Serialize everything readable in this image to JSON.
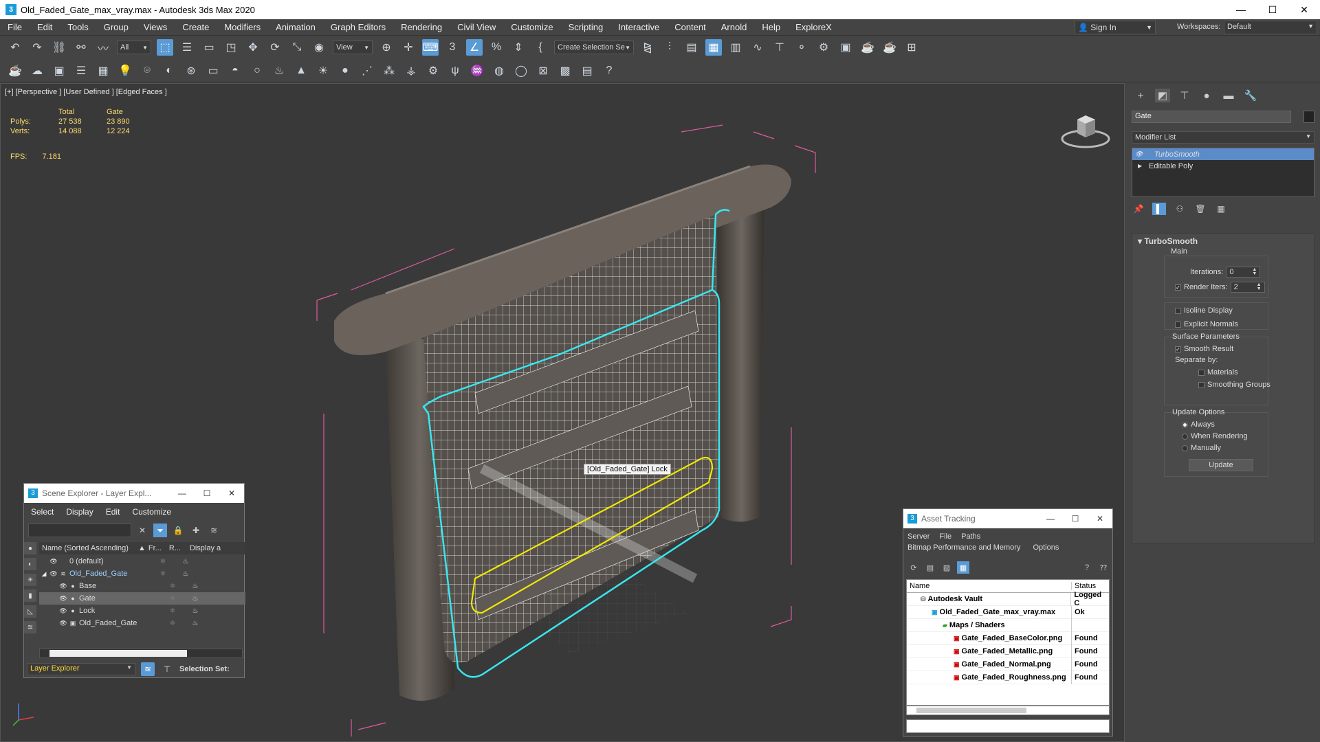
{
  "window": {
    "title": "Old_Faded_Gate_max_vray.max - Autodesk 3ds Max 2020",
    "app_icon": "3"
  },
  "menu": [
    "File",
    "Edit",
    "Tools",
    "Group",
    "Views",
    "Create",
    "Modifiers",
    "Animation",
    "Graph Editors",
    "Rendering",
    "Civil View",
    "Customize",
    "Scripting",
    "Interactive",
    "Content",
    "Arnold",
    "Help",
    "ExploreX"
  ],
  "account": {
    "sign_in": "Sign In",
    "workspaces_label": "Workspaces:",
    "workspace": "Default"
  },
  "toolbar": {
    "filter": "All",
    "view": "View",
    "selection_set": "Create Selection Se"
  },
  "viewport": {
    "label": "[+] [Perspective ] [User Defined ] [Edged Faces ]",
    "stats": {
      "col_total": "Total",
      "col_gate": "Gate",
      "polys_label": "Polys:",
      "polys_total": "27 538",
      "polys_gate": "23 890",
      "verts_label": "Verts:",
      "verts_total": "14 088",
      "verts_gate": "12 224",
      "fps_label": "FPS:",
      "fps_value": "7.181"
    },
    "tooltip": "[Old_Faded_Gate] Lock",
    "colors": {
      "selection": "#39e6ef",
      "highlight": "#f0e800",
      "bbox": "#e05aa0"
    }
  },
  "command_panel": {
    "object_name": "Gate",
    "modifier_list": "Modifier List",
    "stack": [
      {
        "label": "TurboSmooth",
        "selected": true
      },
      {
        "label": "Editable Poly",
        "selected": false
      }
    ],
    "rollout_title": "TurboSmooth",
    "main_label": "Main",
    "iterations_label": "Iterations:",
    "iterations_value": "0",
    "render_iters_label": "Render Iters:",
    "render_iters_value": "2",
    "isoline": "Isoline Display",
    "explicit_normals": "Explicit Normals",
    "surface_params": "Surface Parameters",
    "smooth_result": "Smooth Result",
    "separate_by": "Separate by:",
    "materials": "Materials",
    "smoothing_groups": "Smoothing Groups",
    "update_options": "Update Options",
    "always": "Always",
    "when_rendering": "When Rendering",
    "manually": "Manually",
    "update_button": "Update"
  },
  "scene_explorer": {
    "title": "Scene Explorer - Layer Expl...",
    "menu": [
      "Select",
      "Display",
      "Edit",
      "Customize"
    ],
    "columns": {
      "name": "Name (Sorted Ascending)",
      "sort": "▲",
      "frozen": "Fr...",
      "render": "R...",
      "display": "Display a"
    },
    "rows": [
      {
        "name": "0 (default)",
        "indent": 1,
        "selected": false
      },
      {
        "name": "Old_Faded_Gate",
        "indent": 0,
        "selected": false
      },
      {
        "name": "Base",
        "indent": 2,
        "selected": false
      },
      {
        "name": "Gate",
        "indent": 2,
        "selected": true
      },
      {
        "name": "Lock",
        "indent": 2,
        "selected": false
      },
      {
        "name": "Old_Faded_Gate",
        "indent": 2,
        "selected": false
      }
    ],
    "layer_explorer": "Layer Explorer",
    "selection_set": "Selection Set:"
  },
  "asset_tracking": {
    "title": "Asset Tracking",
    "menu1": [
      "Server",
      "File",
      "Paths"
    ],
    "menu2": [
      "Bitmap Performance and Memory",
      "Options"
    ],
    "columns": {
      "name": "Name",
      "status": "Status"
    },
    "rows": [
      {
        "name": "Autodesk Vault",
        "status": "Logged C",
        "indent": 20
      },
      {
        "name": "Old_Faded_Gate_max_vray.max",
        "status": "Ok",
        "indent": 36
      },
      {
        "name": "Maps / Shaders",
        "status": "",
        "indent": 52
      },
      {
        "name": "Gate_Faded_BaseColor.png",
        "status": "Found",
        "indent": 68
      },
      {
        "name": "Gate_Faded_Metallic.png",
        "status": "Found",
        "indent": 68
      },
      {
        "name": "Gate_Faded_Normal.png",
        "status": "Found",
        "indent": 68
      },
      {
        "name": "Gate_Faded_Roughness.png",
        "status": "Found",
        "indent": 68
      }
    ]
  }
}
